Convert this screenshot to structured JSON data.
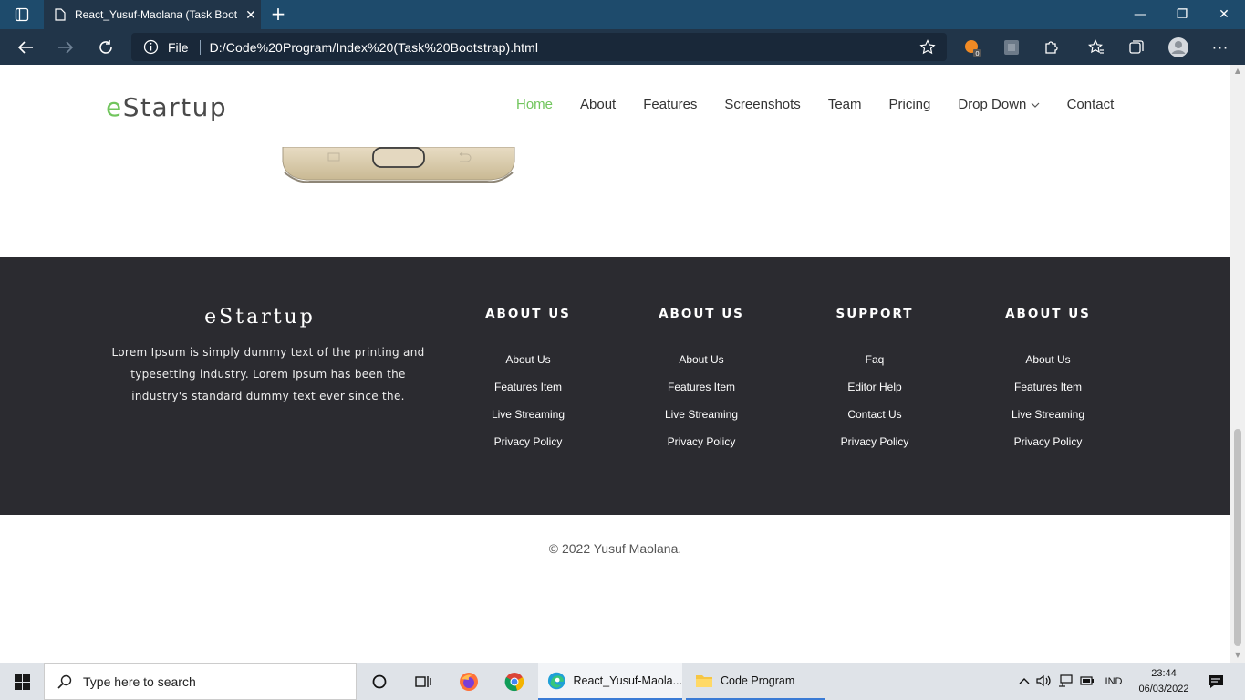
{
  "browser": {
    "tab_title": "React_Yusuf-Maolana (Task Boot",
    "address_scheme": "File",
    "address_url": "D:/Code%20Program/Index%20(Task%20Bootstrap).html",
    "extension_badge": "0"
  },
  "nav": {
    "brand_e": "e",
    "brand_rest": "Startup",
    "items": [
      {
        "label": "Home",
        "active": true
      },
      {
        "label": "About"
      },
      {
        "label": "Features"
      },
      {
        "label": "Screenshots"
      },
      {
        "label": "Team"
      },
      {
        "label": "Pricing"
      },
      {
        "label": "Drop Down"
      },
      {
        "label": "Contact"
      }
    ]
  },
  "footer": {
    "brand": "eStartup",
    "description": "Lorem Ipsum is simply dummy text of the printing and typesetting industry. Lorem Ipsum has been the industry's standard dummy text ever since the.",
    "columns": [
      {
        "title": "ABOUT US",
        "items": [
          "About Us",
          "Features Item",
          "Live Streaming",
          "Privacy Policy"
        ]
      },
      {
        "title": "ABOUT US",
        "items": [
          "About Us",
          "Features Item",
          "Live Streaming",
          "Privacy Policy"
        ]
      },
      {
        "title": "SUPPORT",
        "items": [
          "Faq",
          "Editor Help",
          "Contact Us",
          "Privacy Policy"
        ]
      },
      {
        "title": "ABOUT US",
        "items": [
          "About Us",
          "Features Item",
          "Live Streaming",
          "Privacy Policy"
        ]
      }
    ],
    "copyright": "© 2022 Yusuf Maolana."
  },
  "taskbar": {
    "search_placeholder": "Type here to search",
    "apps": [
      {
        "label": "React_Yusuf-Maola...",
        "icon": "edge-icon"
      },
      {
        "label": "Code Program",
        "icon": "folder-icon"
      }
    ],
    "language": "IND",
    "time": "23:44",
    "date": "06/03/2022"
  },
  "colors": {
    "accent": "#71c55d",
    "footer_bg": "#2b2b30",
    "browser_chrome": "#213549"
  }
}
